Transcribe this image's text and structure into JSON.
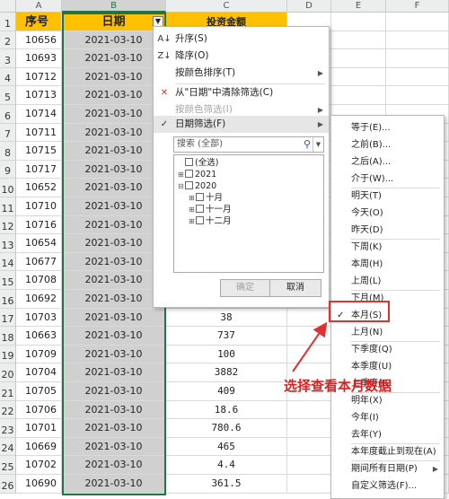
{
  "columns": [
    "A",
    "B",
    "C",
    "D",
    "E",
    "F"
  ],
  "headers": {
    "a": "序号",
    "b": "日期",
    "c": "投资金额"
  },
  "rows": [
    {
      "n": "1",
      "a": "",
      "b": "",
      "c": ""
    },
    {
      "n": "2",
      "a": "10656",
      "b": "2021-03-10",
      "c": ""
    },
    {
      "n": "3",
      "a": "10693",
      "b": "2021-03-10",
      "c": ""
    },
    {
      "n": "4",
      "a": "10712",
      "b": "2021-03-10",
      "c": ""
    },
    {
      "n": "5",
      "a": "10713",
      "b": "2021-03-10",
      "c": ""
    },
    {
      "n": "6",
      "a": "10714",
      "b": "2021-03-10",
      "c": ""
    },
    {
      "n": "7",
      "a": "10711",
      "b": "2021-03-10",
      "c": ""
    },
    {
      "n": "8",
      "a": "10715",
      "b": "2021-03-10",
      "c": ""
    },
    {
      "n": "9",
      "a": "10717",
      "b": "2021-03-10",
      "c": ""
    },
    {
      "n": "10",
      "a": "10652",
      "b": "2021-03-10",
      "c": ""
    },
    {
      "n": "11",
      "a": "10710",
      "b": "2021-03-10",
      "c": ""
    },
    {
      "n": "12",
      "a": "10716",
      "b": "2021-03-10",
      "c": ""
    },
    {
      "n": "13",
      "a": "10654",
      "b": "2021-03-10",
      "c": ""
    },
    {
      "n": "14",
      "a": "10677",
      "b": "2021-03-10",
      "c": ""
    },
    {
      "n": "15",
      "a": "10708",
      "b": "2021-03-10",
      "c": ""
    },
    {
      "n": "16",
      "a": "10692",
      "b": "2021-03-10",
      "c": ""
    },
    {
      "n": "17",
      "a": "10703",
      "b": "2021-03-10",
      "c": "38"
    },
    {
      "n": "18",
      "a": "10663",
      "b": "2021-03-10",
      "c": "737"
    },
    {
      "n": "19",
      "a": "10709",
      "b": "2021-03-10",
      "c": "100"
    },
    {
      "n": "20",
      "a": "10704",
      "b": "2021-03-10",
      "c": "3882"
    },
    {
      "n": "21",
      "a": "10705",
      "b": "2021-03-10",
      "c": "409"
    },
    {
      "n": "22",
      "a": "10706",
      "b": "2021-03-10",
      "c": "18.6"
    },
    {
      "n": "23",
      "a": "10701",
      "b": "2021-03-10",
      "c": "780.6"
    },
    {
      "n": "24",
      "a": "10669",
      "b": "2021-03-10",
      "c": "465"
    },
    {
      "n": "25",
      "a": "10702",
      "b": "2021-03-10",
      "c": "4.4"
    },
    {
      "n": "26",
      "a": "10690",
      "b": "2021-03-10",
      "c": "361.5"
    }
  ],
  "menu": {
    "sort_asc": "升序(S)",
    "sort_desc": "降序(O)",
    "sort_color": "按颜色排序(T)",
    "clear_filter": "从\"日期\"中清除筛选(C)",
    "filter_color": "按颜色筛选(I)",
    "date_filter": "日期筛选(F)",
    "search_placeholder": "搜索 (全部)",
    "ok": "确定",
    "cancel": "取消"
  },
  "tree": {
    "all": "(全选)",
    "y2021": "2021",
    "y2020": "2020",
    "m10": "十月",
    "m11": "十一月",
    "m12": "十二月"
  },
  "submenu": [
    "等于(E)...",
    "之前(B)...",
    "之后(A)...",
    "介于(W)...",
    "明天(T)",
    "今天(O)",
    "昨天(D)",
    "下周(K)",
    "本周(H)",
    "上周(L)",
    "下月(M)",
    "本月(S)",
    "上月(N)",
    "下季度(Q)",
    "本季度(U)",
    "上季度(R)",
    "明年(X)",
    "今年(I)",
    "去年(Y)",
    "本年度截止到现在(A)",
    "期间所有日期(P)",
    "自定义筛选(F)..."
  ],
  "annotation": "选择查看本月数据",
  "colors": {
    "header_fill": "#ffc000",
    "highlight": "#e03030",
    "selection": "#217346"
  }
}
